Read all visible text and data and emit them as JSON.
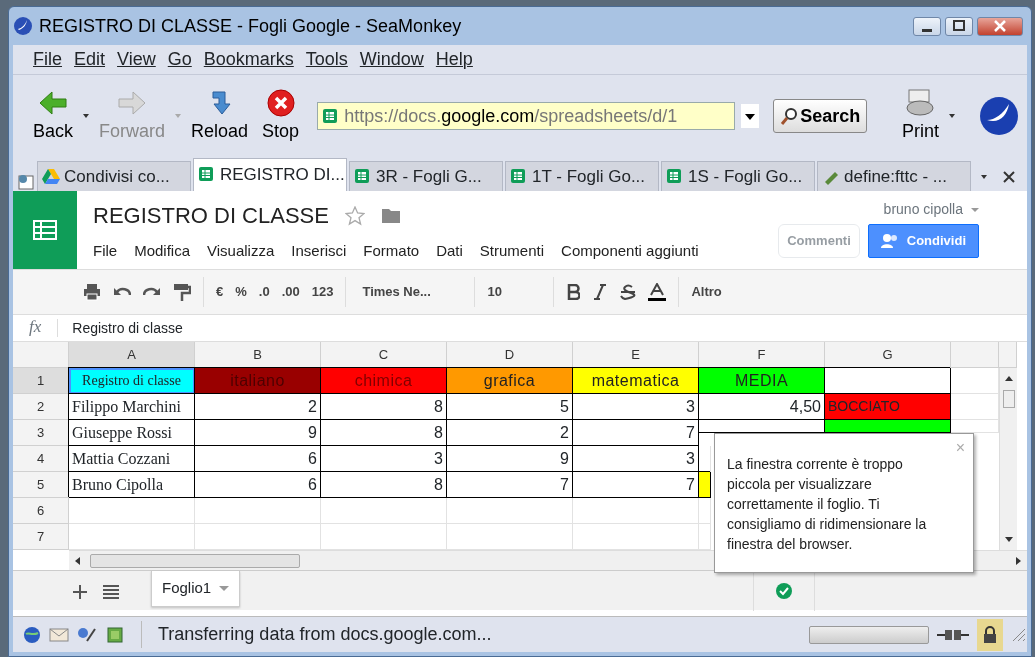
{
  "window": {
    "title": "REGISTRO DI CLASSE - Fogli Google - SeaMonkey"
  },
  "menu": [
    {
      "label": "File"
    },
    {
      "label": "Edit"
    },
    {
      "label": "View"
    },
    {
      "label": "Go"
    },
    {
      "label": "Bookmarks"
    },
    {
      "label": "Tools"
    },
    {
      "label": "Window"
    },
    {
      "label": "Help"
    }
  ],
  "nav_buttons": [
    {
      "kind": "back",
      "label": "Back",
      "disabled": false
    },
    {
      "kind": "forward",
      "label": "Forward",
      "disabled": true
    },
    {
      "kind": "reload",
      "label": "Reload",
      "disabled": false
    },
    {
      "kind": "stop",
      "label": "Stop",
      "disabled": false
    }
  ],
  "address": {
    "prefix": "https://docs.",
    "domain": "google.com",
    "path": "/spreadsheets/d/1"
  },
  "search_button": "Search",
  "print_button": "Print",
  "tabs": [
    {
      "label": "Condivisi co...",
      "kind": "drive",
      "selected": false
    },
    {
      "label": "REGISTRO DI...",
      "kind": "sheet",
      "selected": true
    },
    {
      "label": "3R - Fogli G...",
      "kind": "sheet",
      "selected": false
    },
    {
      "label": "1T - Fogli Go...",
      "kind": "sheet",
      "selected": false
    },
    {
      "label": "1S - Fogli Go...",
      "kind": "sheet",
      "selected": false
    },
    {
      "label": "define:fttc - ...",
      "kind": "search",
      "selected": false
    }
  ],
  "app": {
    "title": "REGISTRO DI CLASSE",
    "user": "bruno cipolla",
    "menus": [
      "File",
      "Modifica",
      "Visualizza",
      "Inserisci",
      "Formato",
      "Dati",
      "Strumenti",
      "Componenti aggiunti"
    ],
    "comments_button": "Commenti",
    "share_button": "Condividi"
  },
  "format_toolbar": {
    "currency": "€",
    "percent": "%",
    "decrease_decimals": ".0",
    "increase_decimals": ".00",
    "number_format": "123",
    "font": "Times Ne...",
    "size": "10",
    "more": "Altro"
  },
  "formula_bar": {
    "label": "fx",
    "value": "Registro di classe"
  },
  "columns": [
    {
      "label": "A",
      "selected": true
    },
    {
      "label": "B",
      "selected": false
    },
    {
      "label": "C",
      "selected": false
    },
    {
      "label": "D",
      "selected": false
    },
    {
      "label": "E",
      "selected": false
    },
    {
      "label": "F",
      "selected": false
    },
    {
      "label": "G",
      "selected": false
    }
  ],
  "rows": [
    {
      "number": "1",
      "selected": true,
      "cells": [
        {
          "kind": "label",
          "text": "Registro di classe",
          "color": "#00ffff"
        },
        {
          "kind": "header",
          "text": "italiano",
          "color": "#990000"
        },
        {
          "kind": "header",
          "text": "chimica",
          "color": "#ff0000"
        },
        {
          "kind": "header",
          "text": "grafica",
          "color": "#ff9900"
        },
        {
          "kind": "header",
          "text": "matematica",
          "color": "#ffff00"
        },
        {
          "kind": "header",
          "text": "MEDIA",
          "color": "#00ff00"
        },
        {
          "kind": "header",
          "color": "#ffffff"
        }
      ]
    },
    {
      "number": "2",
      "selected": false,
      "cells": [
        {
          "kind": "name",
          "text": "Filippo Marchini"
        },
        {
          "kind": "number",
          "text": "2"
        },
        {
          "kind": "number",
          "text": "8"
        },
        {
          "kind": "number",
          "text": "5"
        },
        {
          "kind": "number",
          "text": "3"
        },
        {
          "kind": "number",
          "text": "4,50"
        },
        {
          "kind": "result",
          "text": "BOCCIATO",
          "color": "#ff0000"
        }
      ]
    },
    {
      "number": "3",
      "selected": false,
      "cells": [
        {
          "kind": "name",
          "text": "Giuseppe Rossi"
        },
        {
          "kind": "number",
          "text": "9"
        },
        {
          "kind": "number",
          "text": "8"
        },
        {
          "kind": "number",
          "text": "2"
        },
        {
          "kind": "number",
          "text": "7"
        },
        {
          "kind": "blank"
        },
        {
          "kind": "result",
          "color": "#00ff00"
        }
      ]
    },
    {
      "number": "4",
      "selected": false,
      "cells": [
        {
          "kind": "name",
          "text": "Mattia Cozzani"
        },
        {
          "kind": "number",
          "text": "6"
        },
        {
          "kind": "number",
          "text": "3"
        },
        {
          "kind": "number",
          "text": "9"
        },
        {
          "kind": "number",
          "text": "3"
        }
      ]
    },
    {
      "number": "5",
      "selected": false,
      "cells": [
        {
          "kind": "name",
          "text": "Bruno Cipolla"
        },
        {
          "kind": "number",
          "text": "6"
        },
        {
          "kind": "number",
          "text": "8"
        },
        {
          "kind": "number",
          "text": "7"
        },
        {
          "kind": "number",
          "text": "7"
        },
        {
          "kind": "result",
          "color": "#ffff00"
        }
      ]
    },
    {
      "number": "6",
      "selected": false,
      "cells": []
    },
    {
      "number": "7",
      "selected": false,
      "cells": []
    }
  ],
  "sheet_tab": "Foglio1",
  "popup": "La finestra corrente è troppo piccola per visualizzare correttamente il foglio. Ti consigliamo di ridimensionare la finestra del browser.",
  "popup_close": "×",
  "status_bar": {
    "text": "Transferring data from docs.google.com...",
    "level": 0
  }
}
